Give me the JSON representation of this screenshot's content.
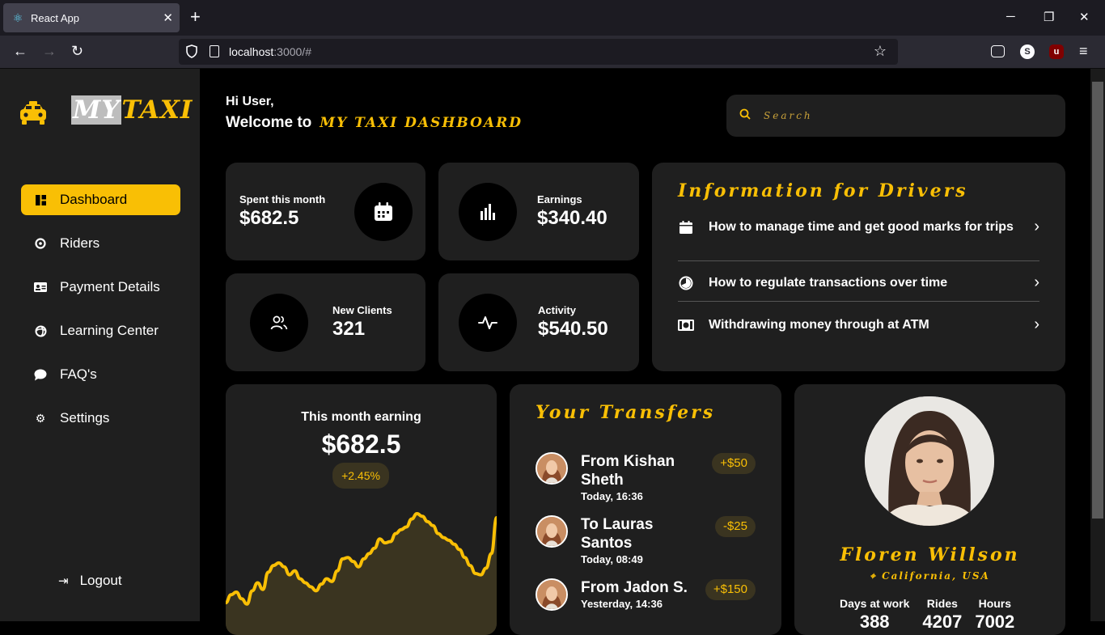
{
  "browser": {
    "tab_title": "React App",
    "url_host": "localhost",
    "url_rest": ":3000/#"
  },
  "sidebar": {
    "logo_my": "MY",
    "logo_taxi": "TAXI",
    "items": [
      {
        "label": "Dashboard",
        "icon": "dashboard-icon"
      },
      {
        "label": "Riders",
        "icon": "riders-icon"
      },
      {
        "label": "Payment Details",
        "icon": "id-card-icon"
      },
      {
        "label": "Learning Center",
        "icon": "learning-icon"
      },
      {
        "label": "FAQ's",
        "icon": "chat-bubble-icon"
      },
      {
        "label": "Settings",
        "icon": "gear-icon"
      }
    ],
    "logout": "Logout"
  },
  "header": {
    "hi": "Hi User,",
    "welcome": "Welcome to",
    "brand": "MY TAXI DASHBOARD",
    "search_placeholder": "Search"
  },
  "stats": {
    "spent": {
      "label": "Spent this month",
      "value": "$682.5"
    },
    "earnings": {
      "label": "Earnings",
      "value": "$340.40"
    },
    "clients": {
      "label": "New Clients",
      "value": "321"
    },
    "activity": {
      "label": "Activity",
      "value": "$540.50"
    }
  },
  "info": {
    "title": "Information for Drivers",
    "items": [
      "How to manage time and get good marks for trips",
      "How to regulate transactions over time",
      "Withdrawing money through at ATM"
    ]
  },
  "earning": {
    "title": "This month earning",
    "value": "$682.5",
    "change": "+2.45%",
    "accent": "#f9bf05"
  },
  "transfers": {
    "title": "Your Transfers",
    "items": [
      {
        "name": "From Kishan Sheth",
        "time": "Today, 16:36",
        "amount": "+$50"
      },
      {
        "name": "To Lauras Santos",
        "time": "Today, 08:49",
        "amount": "-$25"
      },
      {
        "name": "From Jadon S.",
        "time": "Yesterday, 14:36",
        "amount": "+$150"
      }
    ]
  },
  "profile": {
    "name": "Floren Willson",
    "location": "California, USA",
    "stats": [
      {
        "label": "Days at work",
        "value": "388"
      },
      {
        "label": "Rides",
        "value": "4207"
      },
      {
        "label": "Hours",
        "value": "7002"
      }
    ]
  },
  "chart_data": {
    "type": "area",
    "title": "",
    "values": [
      6,
      12,
      14,
      9,
      5,
      15,
      21,
      16,
      29,
      34,
      36,
      33,
      27,
      30,
      24,
      21,
      18,
      15,
      20,
      24,
      22,
      30,
      39,
      40,
      37,
      33,
      39,
      43,
      47,
      54,
      51,
      52,
      58,
      61,
      63,
      69,
      73,
      71,
      67,
      64,
      58,
      55,
      53,
      50,
      46,
      40,
      34,
      28,
      27,
      32,
      43,
      70
    ]
  }
}
